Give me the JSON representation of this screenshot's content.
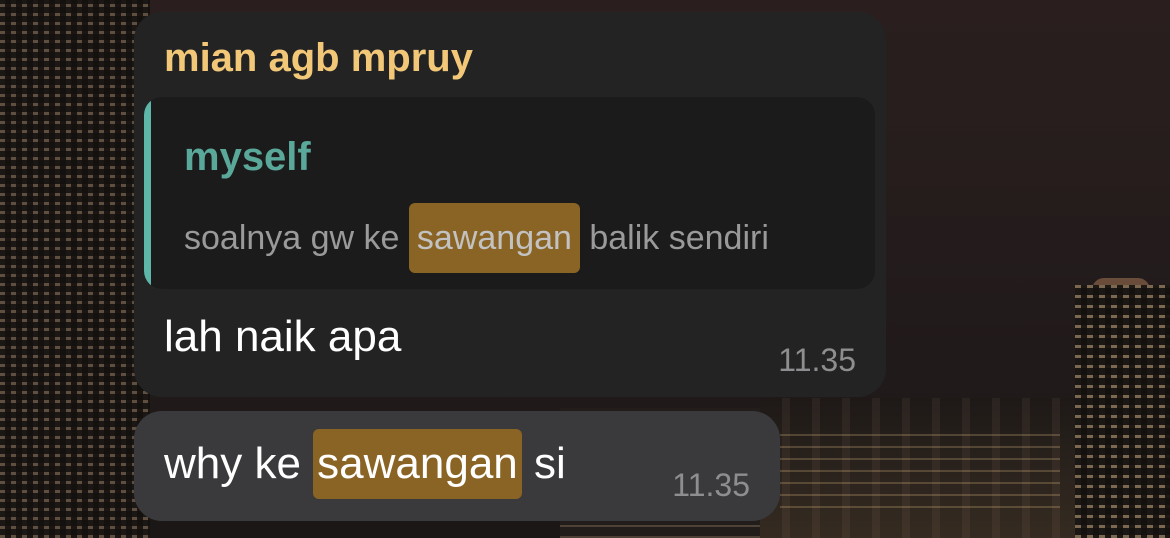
{
  "messages": [
    {
      "sender": "mian agb mpruy",
      "reply": {
        "author": "myself",
        "text_before": "soalnya gw ke ",
        "text_highlight": "sawangan",
        "text_after": " balik sendiri"
      },
      "text": "lah naik apa",
      "time": "11.35"
    },
    {
      "text_before": "why ke ",
      "text_highlight": "sawangan",
      "text_after": " si",
      "time": "11.35"
    }
  ],
  "colors": {
    "sender_name": "#f2c878",
    "reply_author": "#5aa89a",
    "reply_bar": "#5db6a7",
    "search_highlight": "#8a6424",
    "incoming_bubble": "#232324",
    "second_bubble": "#3a3a3c"
  }
}
